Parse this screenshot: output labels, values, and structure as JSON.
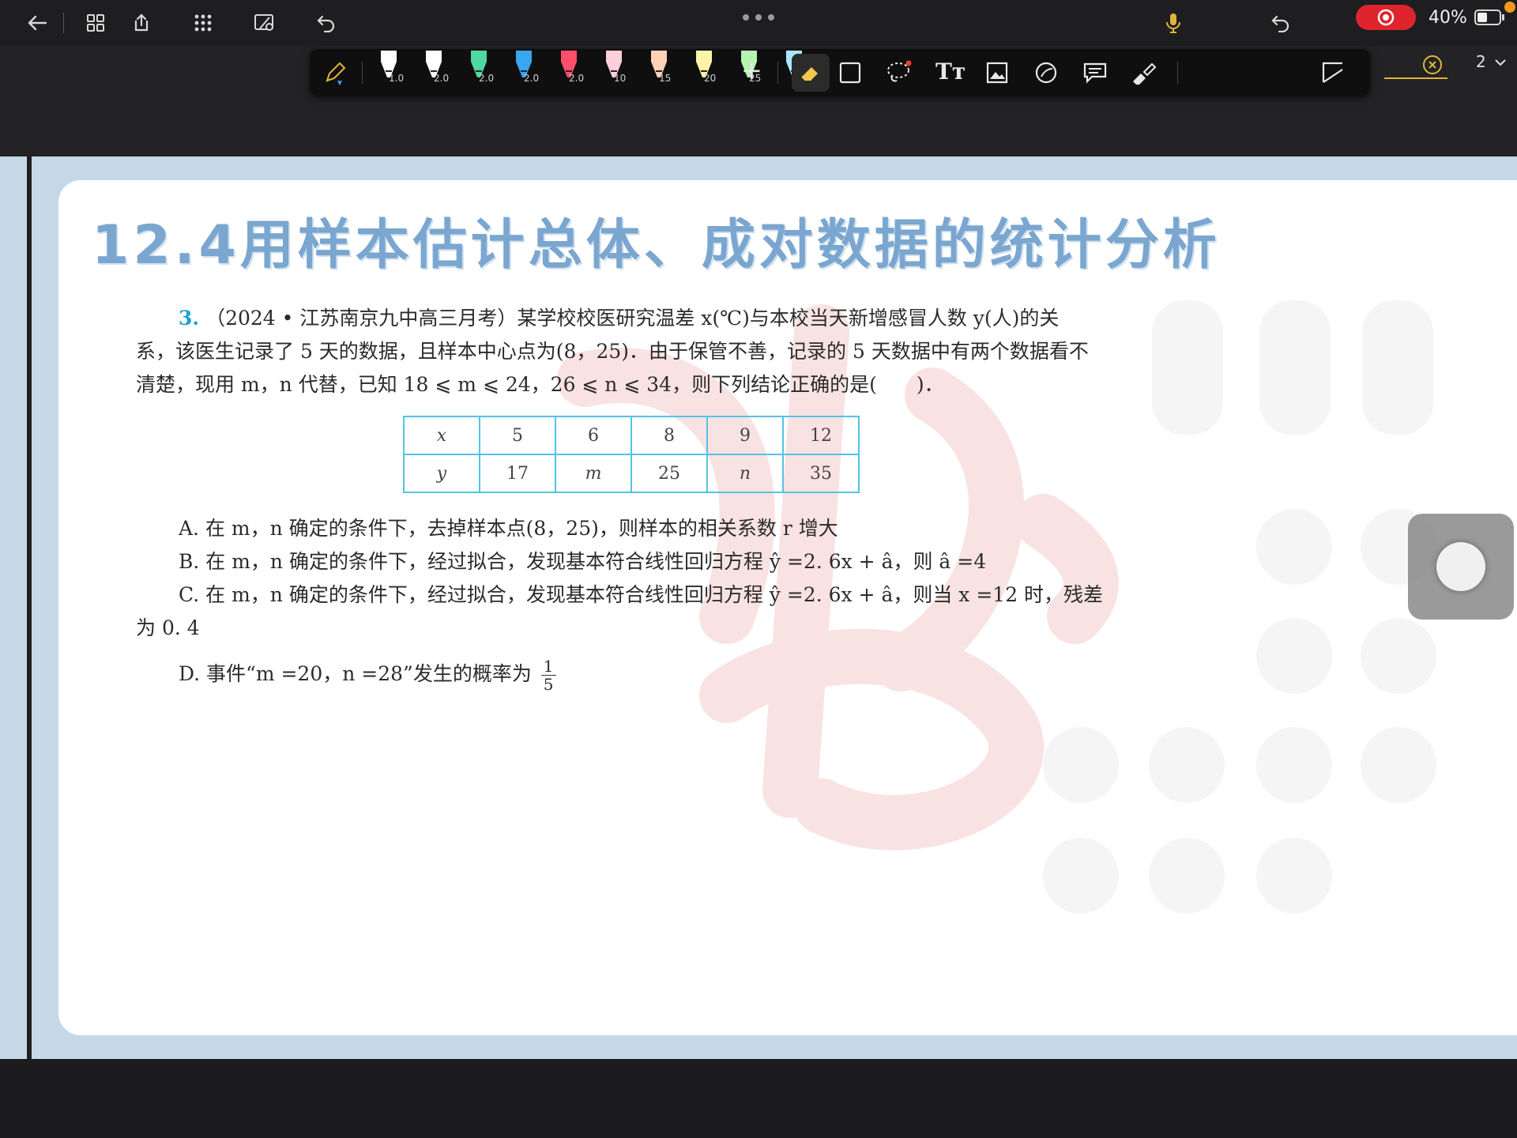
{
  "status": {
    "battery_text": "40%",
    "page_indicator": "2"
  },
  "pen_toolbar": {
    "pens": [
      {
        "width": "1.0",
        "color": "#ffffff"
      },
      {
        "width": "2.0",
        "color": "#ffffff"
      },
      {
        "width": "2.0",
        "color": "#4fd9a0"
      },
      {
        "width": "2.0",
        "color": "#3aa6f2"
      },
      {
        "width": "2.0",
        "color": "#ff4d6a"
      },
      {
        "width": "10",
        "color": "#ffd0dc"
      },
      {
        "width": "15",
        "color": "#ffd2b8"
      },
      {
        "width": "20",
        "color": "#fff3a6"
      },
      {
        "width": "25",
        "color": "#b6f5b0"
      },
      {
        "width": "30",
        "color": "#a8e8ff"
      }
    ],
    "add_label": "+",
    "text_tool_label": "Tт"
  },
  "document": {
    "heading": "12.4用样本估计总体、成对数据的统计分析",
    "question_number": "3.",
    "question_lines": [
      "（2024 • 江苏南京九中高三月考）某学校校医研究温差 x(℃)与本校当天新增感冒人数 y(人)的关",
      "系，该医生记录了 5 天的数据，且样本中心点为(8，25)．由于保管不善，记录的 5 天数据中有两个数据看不",
      "清楚，现用 m，n 代替，已知 18 ⩽ m ⩽ 24，26 ⩽ n ⩽ 34，则下列结论正确的是(　　)．"
    ],
    "table": {
      "row_x": [
        "x",
        "5",
        "6",
        "8",
        "9",
        "12"
      ],
      "row_y": [
        "y",
        "17",
        "m",
        "25",
        "n",
        "35"
      ]
    },
    "options": {
      "A": "A.  在 m，n 确定的条件下，去掉样本点(8，25)，则样本的相关系数 r 增大",
      "B": "B.  在 m，n 确定的条件下，经过拟合，发现基本符合线性回归方程 ŷ =2. 6x + â，则 â =4",
      "C1": "C.  在 m，n 确定的条件下，经过拟合，发现基本符合线性回归方程 ŷ =2. 6x + â，则当 x =12 时，残差",
      "C2": "为 0. 4",
      "D": "D.  事件“m =20，n =28”发生的概率为",
      "D_frac_num": "1",
      "D_frac_den": "5"
    }
  },
  "colors": {
    "heading": "#7aa6cf",
    "table_border": "#53c3e6",
    "question_number": "#1aa1d4",
    "record_indicator": "#e0242e",
    "mic": "#e3b43a"
  }
}
